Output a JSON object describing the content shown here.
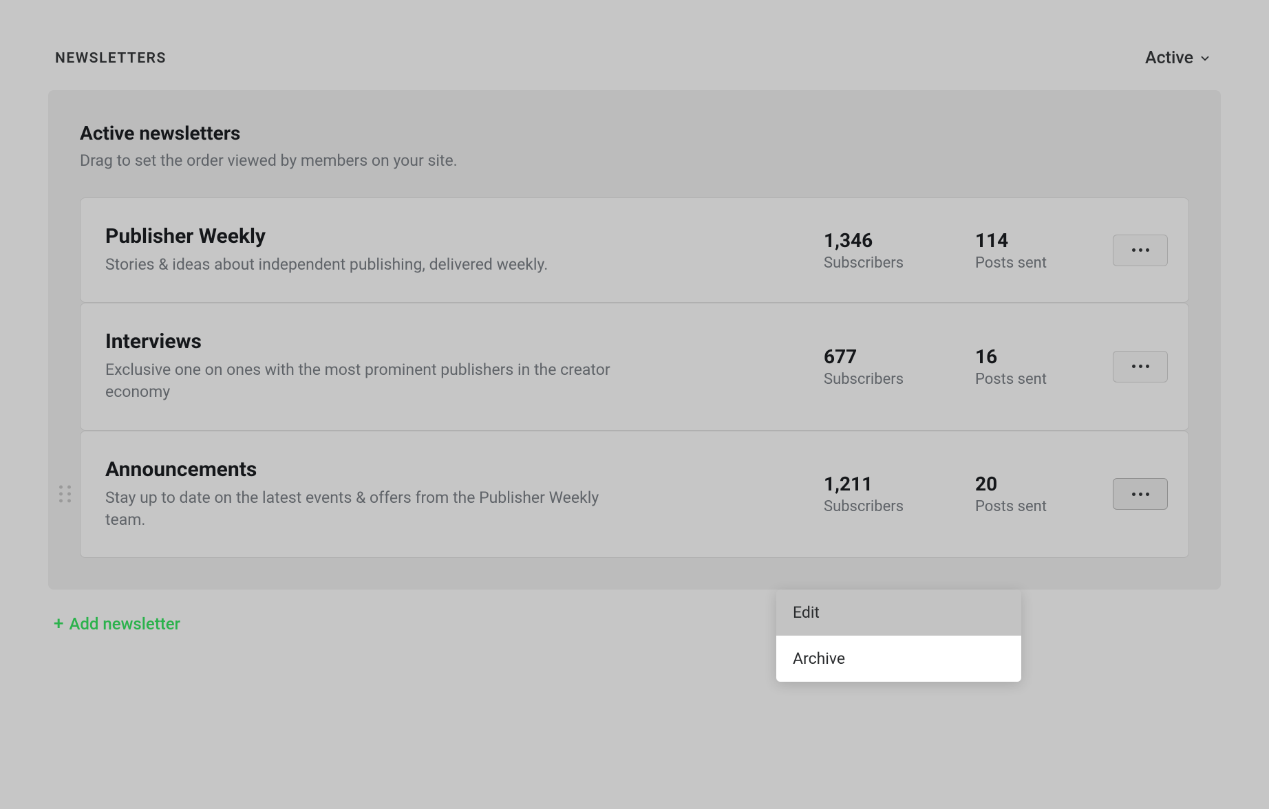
{
  "header": {
    "label": "NEWSLETTERS",
    "filter": "Active"
  },
  "panel": {
    "title": "Active newsletters",
    "subtitle": "Drag to set the order viewed by members on your site."
  },
  "stat_labels": {
    "subscribers": "Subscribers",
    "posts_sent": "Posts sent"
  },
  "newsletters": [
    {
      "title": "Publisher Weekly",
      "description": "Stories & ideas about independent publishing, delivered weekly.",
      "subscribers": "1,346",
      "posts_sent": "114"
    },
    {
      "title": "Interviews",
      "description": "Exclusive one on ones with the most prominent publishers in the creator economy",
      "subscribers": "677",
      "posts_sent": "16"
    },
    {
      "title": "Announcements",
      "description": "Stay up to date on the latest events & offers from the Publisher Weekly team.",
      "subscribers": "1,211",
      "posts_sent": "20"
    }
  ],
  "dropdown": {
    "edit": "Edit",
    "archive": "Archive"
  },
  "add_button": "Add newsletter"
}
